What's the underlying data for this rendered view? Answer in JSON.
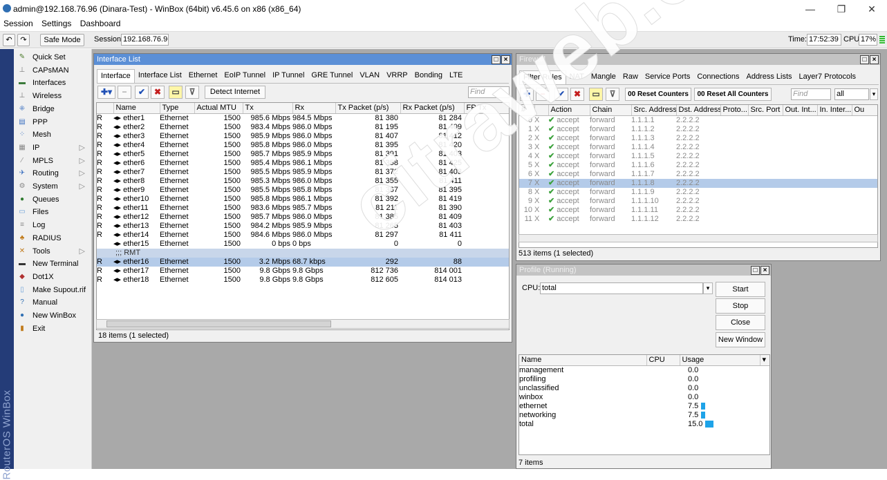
{
  "window": {
    "title": "admin@192.168.76.96 (Dinara-Test) - WinBox (64bit) v6.45.6 on x86 (x86_64)",
    "minimize": "—",
    "maximize": "❐",
    "close": "✕"
  },
  "menubar": [
    "Session",
    "Settings",
    "Dashboard"
  ],
  "toolbar": {
    "undo": "↶",
    "redo": "↷",
    "safe_mode": "Safe Mode",
    "session_label": "Session:",
    "session_value": "192.168.76.96",
    "time_label": "Time:",
    "time_value": "17:52:39",
    "cpu_label": "CPU:",
    "cpu_value": "17%"
  },
  "sidebar": {
    "brand": "RouterOS WinBox",
    "items": [
      {
        "label": "Quick Set",
        "icon": "quick-set-icon",
        "glyph": "✎",
        "color": "#4a7a2a",
        "arrow": false
      },
      {
        "label": "CAPsMAN",
        "icon": "capsman-icon",
        "glyph": "⊥",
        "color": "#777",
        "arrow": false
      },
      {
        "label": "Interfaces",
        "icon": "interfaces-icon",
        "glyph": "▬",
        "color": "#3a7a3a",
        "arrow": false
      },
      {
        "label": "Wireless",
        "icon": "wireless-icon",
        "glyph": "⊥",
        "color": "#777",
        "arrow": false
      },
      {
        "label": "Bridge",
        "icon": "bridge-icon",
        "glyph": "⁜",
        "color": "#3a6fc0",
        "arrow": false
      },
      {
        "label": "PPP",
        "icon": "ppp-icon",
        "glyph": "▤",
        "color": "#3a6fc0",
        "arrow": false
      },
      {
        "label": "Mesh",
        "icon": "mesh-icon",
        "glyph": "⁘",
        "color": "#3a6fc0",
        "arrow": false
      },
      {
        "label": "IP",
        "icon": "ip-icon",
        "glyph": "▦",
        "color": "#888",
        "arrow": true
      },
      {
        "label": "MPLS",
        "icon": "mpls-icon",
        "glyph": "⁄",
        "color": "#888",
        "arrow": true
      },
      {
        "label": "Routing",
        "icon": "routing-icon",
        "glyph": "✈",
        "color": "#3a6fc0",
        "arrow": true
      },
      {
        "label": "System",
        "icon": "system-icon",
        "glyph": "⚙",
        "color": "#888",
        "arrow": true
      },
      {
        "label": "Queues",
        "icon": "queues-icon",
        "glyph": "●",
        "color": "#2f7a2f",
        "arrow": false
      },
      {
        "label": "Files",
        "icon": "files-icon",
        "glyph": "▭",
        "color": "#6aa0d8",
        "arrow": false
      },
      {
        "label": "Log",
        "icon": "log-icon",
        "glyph": "≡",
        "color": "#888",
        "arrow": false
      },
      {
        "label": "RADIUS",
        "icon": "radius-icon",
        "glyph": "♣",
        "color": "#c07a1a",
        "arrow": false
      },
      {
        "label": "Tools",
        "icon": "tools-icon",
        "glyph": "✕",
        "color": "#c07a1a",
        "arrow": true
      },
      {
        "label": "New Terminal",
        "icon": "terminal-icon",
        "glyph": "▬",
        "color": "#333",
        "arrow": false
      },
      {
        "label": "Dot1X",
        "icon": "dot1x-icon",
        "glyph": "◆",
        "color": "#b03030",
        "arrow": false
      },
      {
        "label": "Make Supout.rif",
        "icon": "supout-icon",
        "glyph": "▯",
        "color": "#6aa0d8",
        "arrow": false
      },
      {
        "label": "Manual",
        "icon": "manual-icon",
        "glyph": "?",
        "color": "#2f6fb3",
        "arrow": false
      },
      {
        "label": "New WinBox",
        "icon": "winbox-icon",
        "glyph": "●",
        "color": "#2f6fb3",
        "arrow": false
      },
      {
        "label": "Exit",
        "icon": "exit-icon",
        "glyph": "▮",
        "color": "#c07a1a",
        "arrow": false
      }
    ]
  },
  "interface_list": {
    "title": "Interface List",
    "tabs": [
      "Interface",
      "Interface List",
      "Ethernet",
      "EoIP Tunnel",
      "IP Tunnel",
      "GRE Tunnel",
      "VLAN",
      "VRRP",
      "Bonding",
      "LTE"
    ],
    "active_tab": "Interface",
    "detect_internet": "Detect Internet",
    "find_placeholder": "Find",
    "columns": [
      "",
      "Name",
      "Type",
      "Actual MTU",
      "Tx",
      "Rx",
      "Tx Packet (p/s)",
      "Rx Packet (p/s)",
      "FP Tx"
    ],
    "rows": [
      {
        "flag": "R",
        "name": "ether1",
        "type": "Ethernet",
        "mtu": "1500",
        "tx": "985.6 Mbps",
        "rx": "984.5 Mbps",
        "txp": "81 380",
        "rxp": "81 284"
      },
      {
        "flag": "R",
        "name": "ether2",
        "type": "Ethernet",
        "mtu": "1500",
        "tx": "983.4 Mbps",
        "rx": "986.0 Mbps",
        "txp": "81 195",
        "rxp": "81 409"
      },
      {
        "flag": "R",
        "name": "ether3",
        "type": "Ethernet",
        "mtu": "1500",
        "tx": "985.9 Mbps",
        "rx": "986.0 Mbps",
        "txp": "81 407",
        "rxp": "81 412"
      },
      {
        "flag": "R",
        "name": "ether4",
        "type": "Ethernet",
        "mtu": "1500",
        "tx": "985.8 Mbps",
        "rx": "986.0 Mbps",
        "txp": "81 395",
        "rxp": "81 420"
      },
      {
        "flag": "R",
        "name": "ether5",
        "type": "Ethernet",
        "mtu": "1500",
        "tx": "985.7 Mbps",
        "rx": "985.9 Mbps",
        "txp": "81 391",
        "rxp": "81 403"
      },
      {
        "flag": "R",
        "name": "ether6",
        "type": "Ethernet",
        "mtu": "1500",
        "tx": "985.4 Mbps",
        "rx": "986.1 Mbps",
        "txp": "81 358",
        "rxp": "81 425"
      },
      {
        "flag": "R",
        "name": "ether7",
        "type": "Ethernet",
        "mtu": "1500",
        "tx": "985.5 Mbps",
        "rx": "985.9 Mbps",
        "txp": "81 372",
        "rxp": "81 403"
      },
      {
        "flag": "R",
        "name": "ether8",
        "type": "Ethernet",
        "mtu": "1500",
        "tx": "985.3 Mbps",
        "rx": "986.0 Mbps",
        "txp": "81 355",
        "rxp": "81 411"
      },
      {
        "flag": "R",
        "name": "ether9",
        "type": "Ethernet",
        "mtu": "1500",
        "tx": "985.5 Mbps",
        "rx": "985.8 Mbps",
        "txp": "81 367",
        "rxp": "81 395"
      },
      {
        "flag": "R",
        "name": "ether10",
        "type": "Ethernet",
        "mtu": "1500",
        "tx": "985.8 Mbps",
        "rx": "986.1 Mbps",
        "txp": "81 392",
        "rxp": "81 419"
      },
      {
        "flag": "R",
        "name": "ether11",
        "type": "Ethernet",
        "mtu": "1500",
        "tx": "983.6 Mbps",
        "rx": "985.7 Mbps",
        "txp": "81 211",
        "rxp": "81 390"
      },
      {
        "flag": "R",
        "name": "ether12",
        "type": "Ethernet",
        "mtu": "1500",
        "tx": "985.7 Mbps",
        "rx": "986.0 Mbps",
        "txp": "81 385",
        "rxp": "81 409"
      },
      {
        "flag": "R",
        "name": "ether13",
        "type": "Ethernet",
        "mtu": "1500",
        "tx": "984.2 Mbps",
        "rx": "985.9 Mbps",
        "txp": "81 265",
        "rxp": "81 403"
      },
      {
        "flag": "R",
        "name": "ether14",
        "type": "Ethernet",
        "mtu": "1500",
        "tx": "984.6 Mbps",
        "rx": "986.0 Mbps",
        "txp": "81 297",
        "rxp": "81 411"
      },
      {
        "flag": "",
        "name": "ether15",
        "type": "Ethernet",
        "mtu": "1500",
        "tx": "0 bps",
        "rx": "0 bps",
        "txp": "0",
        "rxp": "0"
      },
      {
        "section": ";;; RMT"
      },
      {
        "flag": "R",
        "name": "ether16",
        "type": "Ethernet",
        "mtu": "1500",
        "tx": "3.2 Mbps",
        "rx": "68.7 kbps",
        "txp": "292",
        "rxp": "88",
        "selected": true
      },
      {
        "flag": "R",
        "name": "ether17",
        "type": "Ethernet",
        "mtu": "1500",
        "tx": "9.8 Gbps",
        "rx": "9.8 Gbps",
        "txp": "812 736",
        "rxp": "814 001"
      },
      {
        "flag": "R",
        "name": "ether18",
        "type": "Ethernet",
        "mtu": "1500",
        "tx": "9.8 Gbps",
        "rx": "9.8 Gbps",
        "txp": "812 605",
        "rxp": "814 013"
      }
    ],
    "status": "18 items (1 selected)"
  },
  "firewall": {
    "title": "Firewall",
    "tabs": [
      "Filter Rules",
      "NAT",
      "Mangle",
      "Raw",
      "Service Ports",
      "Connections",
      "Address Lists",
      "Layer7 Protocols"
    ],
    "active_tab": "Filter Rules",
    "reset_counters": "00 Reset Counters",
    "reset_all_counters": "00 Reset All Counters",
    "find_placeholder": "Find",
    "filter_value": "all",
    "columns": [
      "#",
      "Action",
      "Chain",
      "Src. Address",
      "Dst. Address",
      "Proto...",
      "Src. Port",
      "Out. Int...",
      "In. Inter...",
      "Ou"
    ],
    "rows": [
      {
        "num": "0",
        "flag": "X",
        "action": "accept",
        "chain": "forward",
        "src": "1.1.1.1",
        "dst": "2.2.2.2"
      },
      {
        "num": "1",
        "flag": "X",
        "action": "accept",
        "chain": "forward",
        "src": "1.1.1.2",
        "dst": "2.2.2.2"
      },
      {
        "num": "2",
        "flag": "X",
        "action": "accept",
        "chain": "forward",
        "src": "1.1.1.3",
        "dst": "2.2.2.2"
      },
      {
        "num": "3",
        "flag": "X",
        "action": "accept",
        "chain": "forward",
        "src": "1.1.1.4",
        "dst": "2.2.2.2"
      },
      {
        "num": "4",
        "flag": "X",
        "action": "accept",
        "chain": "forward",
        "src": "1.1.1.5",
        "dst": "2.2.2.2"
      },
      {
        "num": "5",
        "flag": "X",
        "action": "accept",
        "chain": "forward",
        "src": "1.1.1.6",
        "dst": "2.2.2.2"
      },
      {
        "num": "6",
        "flag": "X",
        "action": "accept",
        "chain": "forward",
        "src": "1.1.1.7",
        "dst": "2.2.2.2"
      },
      {
        "num": "7",
        "flag": "X",
        "action": "accept",
        "chain": "forward",
        "src": "1.1.1.8",
        "dst": "2.2.2.2",
        "selected": true
      },
      {
        "num": "8",
        "flag": "X",
        "action": "accept",
        "chain": "forward",
        "src": "1.1.1.9",
        "dst": "2.2.2.2"
      },
      {
        "num": "9",
        "flag": "X",
        "action": "accept",
        "chain": "forward",
        "src": "1.1.1.10",
        "dst": "2.2.2.2"
      },
      {
        "num": "10",
        "flag": "X",
        "action": "accept",
        "chain": "forward",
        "src": "1.1.1.11",
        "dst": "2.2.2.2"
      },
      {
        "num": "11",
        "flag": "X",
        "action": "accept",
        "chain": "forward",
        "src": "1.1.1.12",
        "dst": "2.2.2.2"
      }
    ],
    "status": "513 items (1 selected)"
  },
  "profile": {
    "title": "Profile (Running)",
    "cpu_label": "CPU:",
    "cpu_value": "total",
    "buttons": [
      "Start",
      "Stop",
      "Close",
      "New Window"
    ],
    "columns": [
      "Name",
      "CPU",
      "Usage"
    ],
    "rows": [
      {
        "name": "management",
        "cpu": "",
        "usage": "0.0",
        "level": 0
      },
      {
        "name": "profiling",
        "cpu": "",
        "usage": "0.0",
        "level": 0
      },
      {
        "name": "unclassified",
        "cpu": "",
        "usage": "0.0",
        "level": 0
      },
      {
        "name": "winbox",
        "cpu": "",
        "usage": "0.0",
        "level": 0
      },
      {
        "name": "ethernet",
        "cpu": "",
        "usage": "7.5",
        "level": 7.5
      },
      {
        "name": "networking",
        "cpu": "",
        "usage": "7.5",
        "level": 7.5
      },
      {
        "name": "total",
        "cpu": "",
        "usage": "15.0",
        "level": 15
      }
    ],
    "status": "7 items"
  },
  "watermark": "citraweb.com"
}
